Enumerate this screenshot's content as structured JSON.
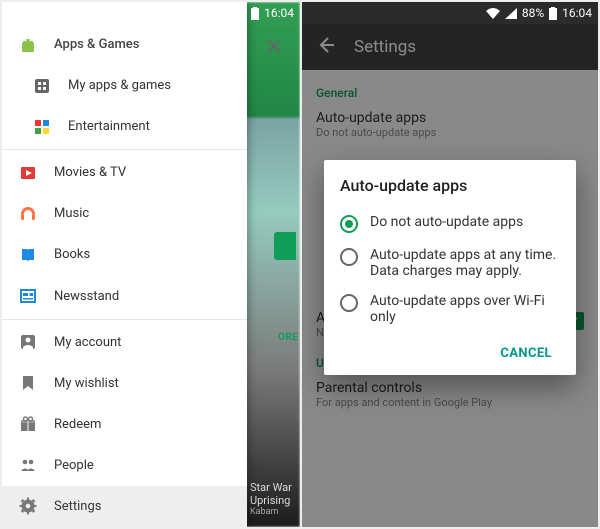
{
  "status": {
    "battery_pct": "88%",
    "time": "16:04"
  },
  "left": {
    "drawer": {
      "header": "Apps & Games",
      "sub_items": [
        "My apps & games",
        "Entertainment"
      ],
      "media_items": [
        "Movies & TV",
        "Music",
        "Books",
        "Newsstand"
      ],
      "account_items": [
        "My account",
        "My wishlist",
        "Redeem",
        "People",
        "Settings"
      ]
    },
    "peek": {
      "title_a": "Star War",
      "title_b": "Uprising",
      "meta": "Kabam",
      "chip": "ORE"
    }
  },
  "right": {
    "appbar_title": "Settings",
    "general_label": "General",
    "auto_update_title": "Auto-update apps",
    "auto_update_sub": "Do not auto-update apps",
    "notify_title": "Apps were auto-updated",
    "notify_sub": "Notify when apps are automatically updated",
    "user_controls_label": "User controls",
    "parental_title": "Parental controls",
    "parental_sub": "For apps and content in Google Play",
    "dialog": {
      "title": "Auto-update apps",
      "options": [
        "Do not auto-update apps",
        "Auto-update apps at any time. Data charges may apply.",
        "Auto-update apps over Wi-Fi only"
      ],
      "cancel": "CANCEL"
    }
  }
}
